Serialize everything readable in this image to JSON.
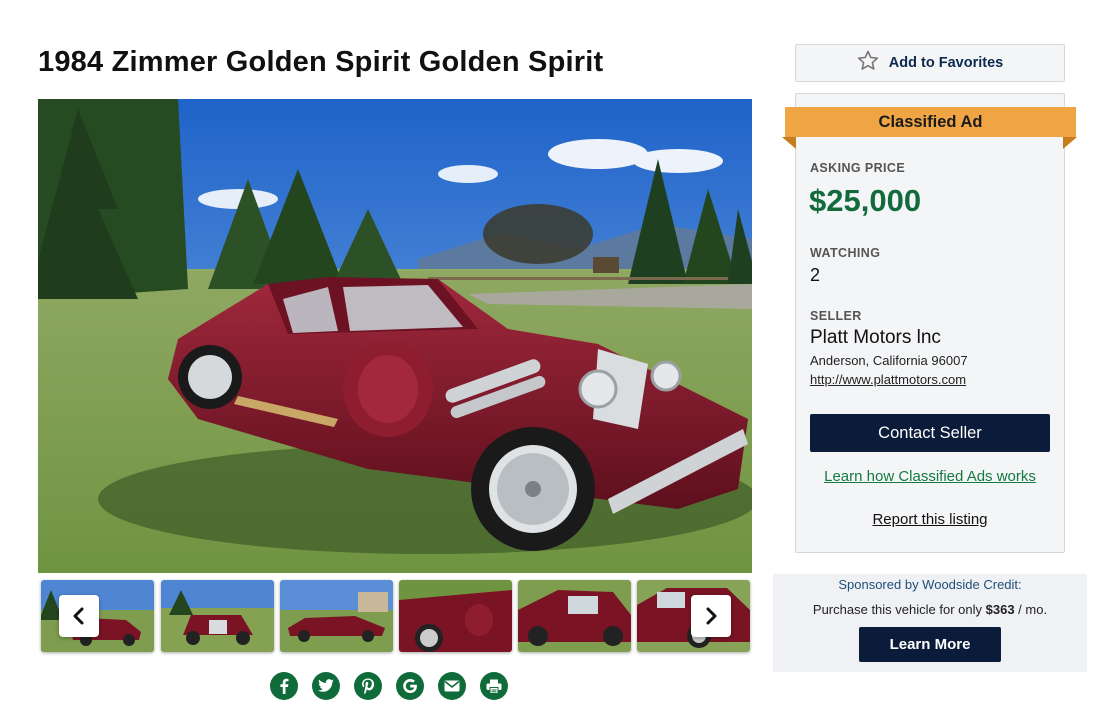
{
  "listing": {
    "title": "1984 Zimmer Golden Spirit Golden Spirit"
  },
  "favorites": {
    "label": "Add to Favorites",
    "icon": "star-outline-icon"
  },
  "classified": {
    "ribbon": "Classified Ad",
    "asking_price_label": "ASKING PRICE",
    "asking_price": "$25,000",
    "watching_label": "WATCHING",
    "watching_count": "2",
    "seller_label": "SELLER",
    "seller_name": "Platt Motors lnc",
    "seller_location": "Anderson, California 96007",
    "seller_url": "http://www.plattmotors.com",
    "contact_button": "Contact Seller",
    "learn_link": "Learn how Classified Ads works",
    "report_link": "Report this listing"
  },
  "sponsor": {
    "title": "Sponsored by Woodside Credit:",
    "line_prefix": "Purchase this vehicle for only",
    "monthly_amount": "$363",
    "line_suffix": "/ mo.",
    "button": "Learn More"
  },
  "gallery": {
    "thumbnail_count": 6,
    "prev_icon": "chevron-left-icon",
    "next_icon": "chevron-right-icon"
  },
  "share": {
    "icons": [
      "facebook-icon",
      "twitter-icon",
      "pinterest-icon",
      "google-icon",
      "email-icon",
      "print-icon"
    ]
  },
  "colors": {
    "price_green": "#136b3c",
    "navy": "#0b1c3a",
    "ribbon_orange": "#f0a544",
    "car_burgundy": "#7a1424"
  }
}
